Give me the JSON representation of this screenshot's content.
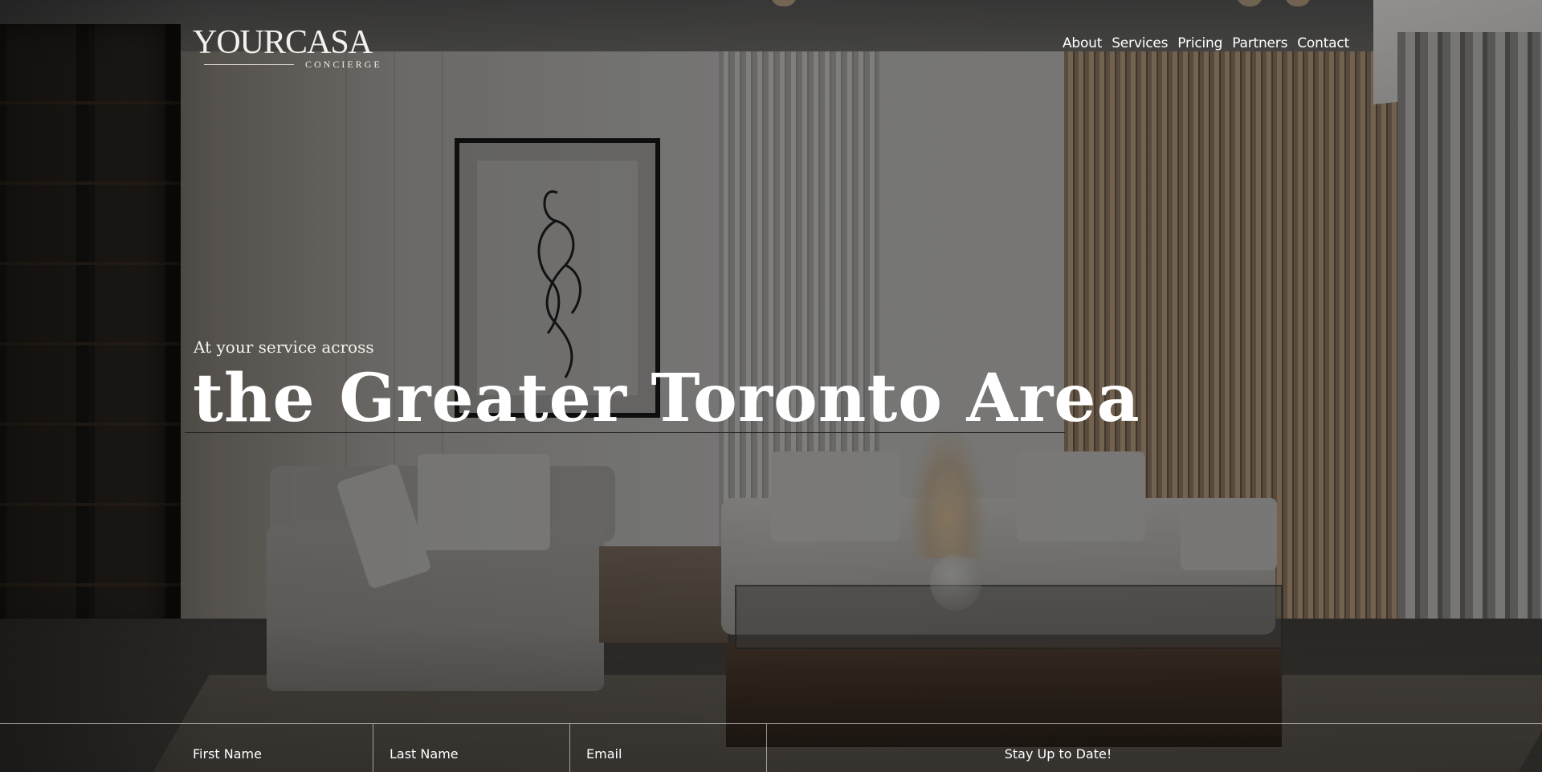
{
  "brand": {
    "name": "YOURCASA",
    "tagline": "CONCIERGE"
  },
  "nav": {
    "items": [
      {
        "label": "About"
      },
      {
        "label": "Services"
      },
      {
        "label": "Pricing"
      },
      {
        "label": "Partners"
      },
      {
        "label": "Contact"
      }
    ]
  },
  "hero": {
    "kicker": "At your service across",
    "title": "the Greater Toronto Area"
  },
  "signup": {
    "first_name_placeholder": "First Name",
    "last_name_placeholder": "Last Name",
    "email_placeholder": "Email",
    "submit_label": "Stay Up to Date!"
  }
}
